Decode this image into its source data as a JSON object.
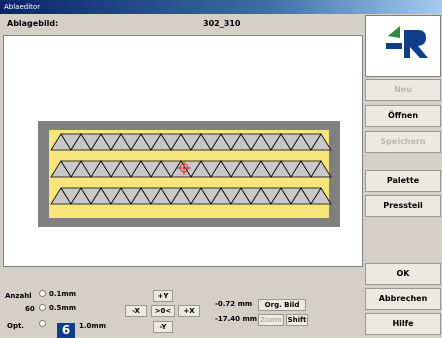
{
  "window": {
    "title": "Ablaeditor"
  },
  "header": {
    "label": "Ablagebild:",
    "value": "302_310"
  },
  "rightcol": {
    "logo_text": "R",
    "buttons": [
      {
        "label": "Neu",
        "enabled": false
      },
      {
        "label": "Öffnen",
        "enabled": true
      },
      {
        "label": "Speichern",
        "enabled": false
      },
      {
        "label": "Palette",
        "enabled": true
      },
      {
        "label": "Pressteil",
        "enabled": true
      }
    ],
    "ok_label": "OK",
    "cancel_label": "Abbrechen",
    "help_label": "Hilfe"
  },
  "bottom": {
    "anzahl_label": "Anzahl",
    "anzahl_value": "60",
    "opt_label": "Opt.",
    "steps": [
      "0.1mm",
      "0.5mm",
      "1.0mm"
    ],
    "plus_y": "+Y",
    "minus_x": "-X",
    "center": ">0<",
    "plus_x": "+X",
    "minus_y": "-Y",
    "coord_x": "-0.72 mm",
    "coord_y": "-17.40 mm",
    "org_bild": "Org. Bild",
    "zoom": "Zoom",
    "shift": "Shift"
  },
  "badge": "6",
  "colors": {
    "title_bar": "#0a246a",
    "sheet": "#f7e47a",
    "frame": "#808080",
    "triangle_fill": "#c8c8c8",
    "accent": "#d23020"
  }
}
